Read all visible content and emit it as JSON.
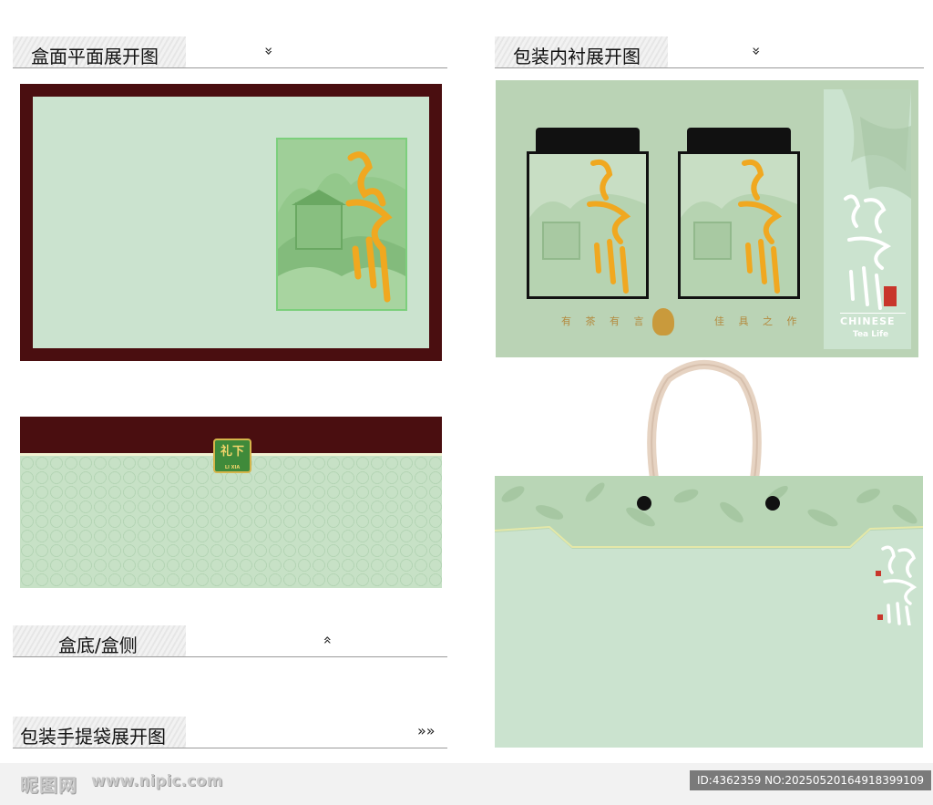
{
  "sections": {
    "box_plan": {
      "title": "盒面平面展开图",
      "chevron": "»"
    },
    "inner_tray": {
      "title": "包装内衬展开图",
      "chevron": "»"
    },
    "box_bottom": {
      "title": "盒底/盒侧",
      "chevron": "»"
    },
    "handbag": {
      "title": "包装手提袋展开图",
      "chevron": "»»"
    }
  },
  "box_side": {
    "seal_text": "礼下",
    "seal_sub": "LI XIA"
  },
  "tray": {
    "left_text": "有 茶 有 言",
    "right_text": "佳 具 之 作",
    "side_en1": "CHINESE",
    "side_en2": "Tea Life"
  },
  "footer": {
    "logo": "昵图网",
    "site": "www.nipic.com",
    "id_text": "ID:4362359 NO:20250520164918399109"
  },
  "colors": {
    "maroon": "#4a0e10",
    "mint": "#cbe3cf",
    "sage": "#bad3b5",
    "gold": "#f0a820"
  },
  "icons": {
    "section_toggle": "chevron-icon",
    "seal": "seal-icon"
  }
}
